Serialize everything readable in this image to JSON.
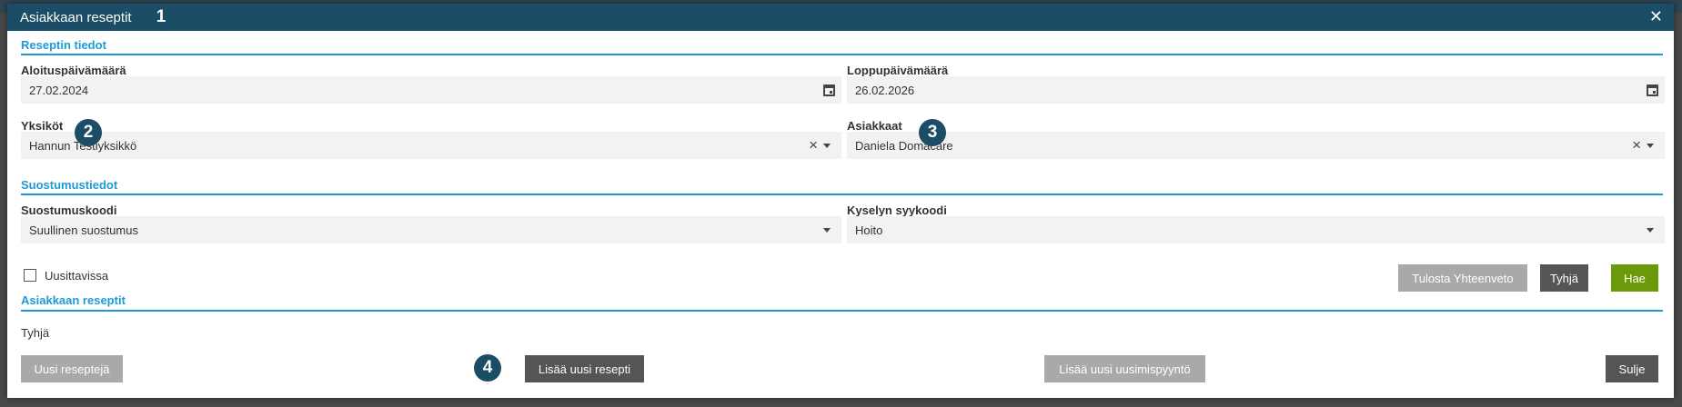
{
  "modal": {
    "title": "Asiakkaan reseptit",
    "close_glyph": "✕"
  },
  "badges": [
    "1",
    "2",
    "3",
    "4"
  ],
  "sections": {
    "prescription_info": "Reseptin tiedot",
    "consent_info": "Suostumustiedot",
    "customer_prescriptions": "Asiakkaan reseptit"
  },
  "fields": {
    "start_date": {
      "label": "Aloituspäivämäärä",
      "value": "27.02.2024",
      "icon": "calendar-icon"
    },
    "end_date": {
      "label": "Loppupäivämäärä",
      "value": "26.02.2026",
      "icon": "calendar-icon"
    },
    "units": {
      "label": "Yksiköt",
      "value": "Hannun Testiyksikkö"
    },
    "customers": {
      "label": "Asiakkaat",
      "value": "Daniela Domacare"
    },
    "consent_code": {
      "label": "Suostumuskoodi",
      "value": "Suullinen suostumus"
    },
    "query_reason": {
      "label": "Kyselyn syykoodi",
      "value": "Hoito"
    }
  },
  "renewable": {
    "label": "Uusittavissa",
    "checked": false
  },
  "buttons": {
    "print_summary": "Tulosta Yhteenveto",
    "clear": "Tyhjä",
    "search": "Hae",
    "new_prescriptions": "Uusi reseptejä",
    "add_prescription": "Lisää uusi resepti",
    "add_renewal_request": "Lisää uusi uusimispyyntö",
    "close": "Sulje"
  },
  "results": {
    "empty_text": "Tyhjä"
  },
  "colors": {
    "header": "#1b4d66",
    "accent": "#1e9ad6",
    "search_button": "#6a9a0a",
    "dark_button": "#555555",
    "grey_button": "#a9a9a9"
  }
}
